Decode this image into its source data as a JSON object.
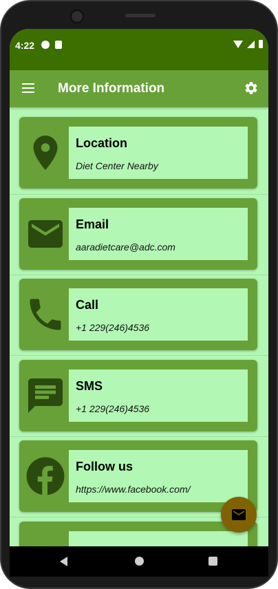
{
  "status_bar": {
    "time": "4:22"
  },
  "app_bar": {
    "title": "More Information",
    "menu_icon": "hamburger-menu-icon",
    "settings_icon": "gear-icon"
  },
  "cards": [
    {
      "title": "Location",
      "subtitle": "Diet Center Nearby",
      "icon": "location-pin-icon"
    },
    {
      "title": "Email",
      "subtitle": "aaradietcare@adc.com",
      "icon": "mail-icon"
    },
    {
      "title": "Call",
      "subtitle": "+1 229(246)4536",
      "icon": "phone-icon"
    },
    {
      "title": "SMS",
      "subtitle": "+1 229(246)4536",
      "icon": "message-icon"
    },
    {
      "title": "Follow us",
      "subtitle": "https://www.facebook.com/",
      "icon": "facebook-icon"
    }
  ],
  "fab": {
    "icon": "mail-icon"
  },
  "colors": {
    "status_bar": "#3c6e00",
    "app_bar": "#68a137",
    "background": "#b3f7b5",
    "card": "#68a137",
    "icon": "#2b4a10",
    "fab": "#806200"
  }
}
